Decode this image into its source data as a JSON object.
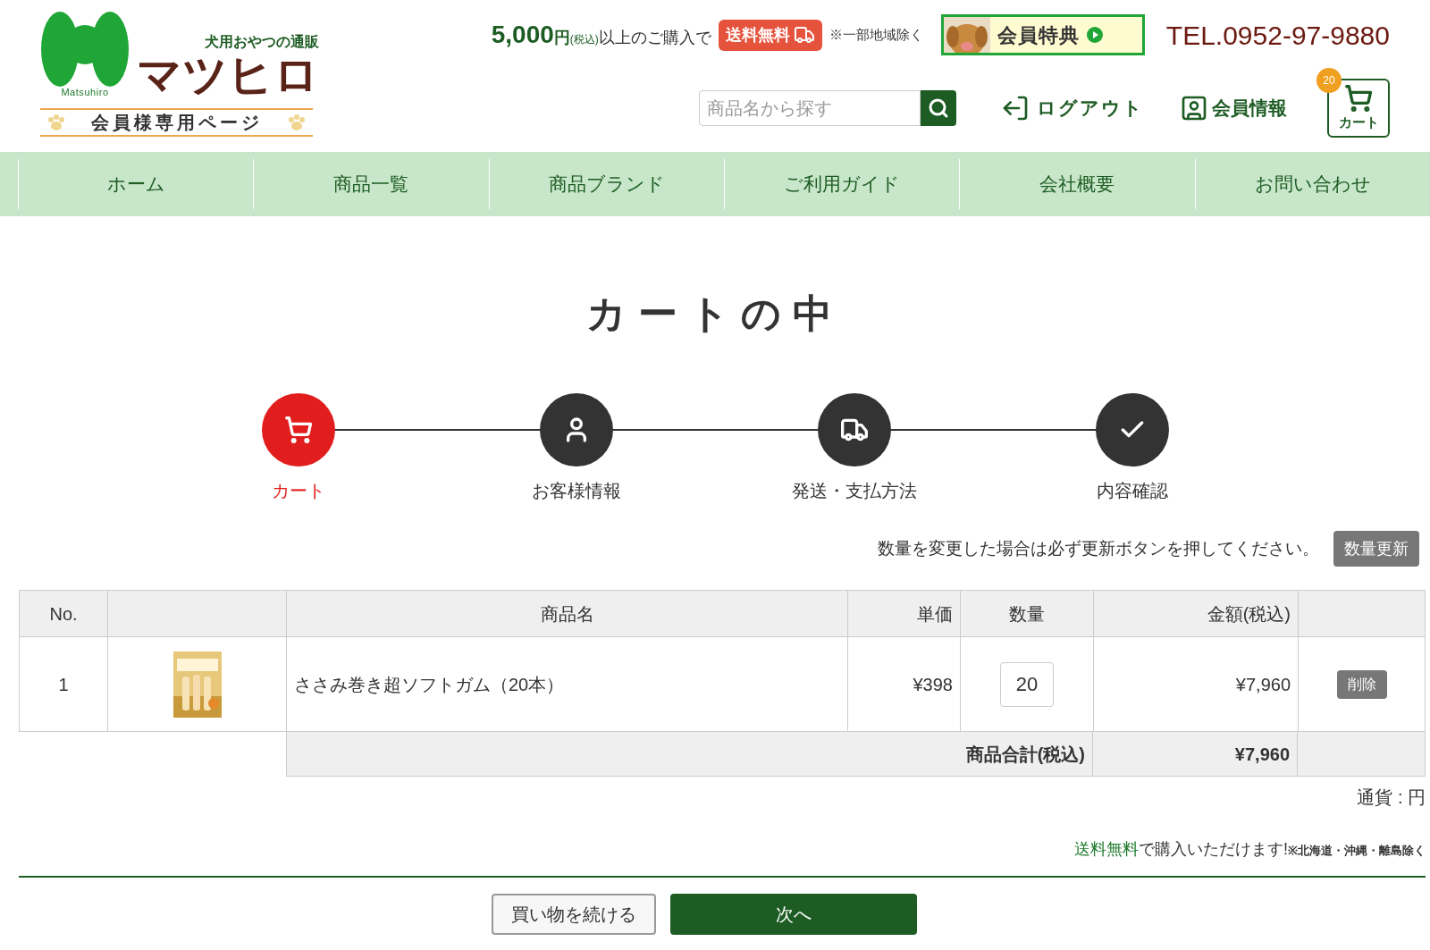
{
  "header": {
    "tagline": "犬用おやつの通販",
    "brand": "マツヒロ",
    "brand_roman": "Matsuhiro",
    "member_page": "会員様専用ページ",
    "shipping": {
      "amount": "5,000",
      "unit": "円",
      "tax": "(税込)",
      "text": "以上のご購入で",
      "badge": "送料無料",
      "note": "※一部地域除く"
    },
    "member_banner": "会員特典",
    "tel": "TEL.0952-97-9880",
    "search": {
      "placeholder": "商品名から探す"
    },
    "logout": "ログアウト",
    "member_info": "会員情報",
    "cart": {
      "label": "カート",
      "count": "20"
    }
  },
  "nav": [
    "ホーム",
    "商品一覧",
    "商品ブランド",
    "ご利用ガイド",
    "会社概要",
    "お問い合わせ"
  ],
  "title": "カートの中",
  "steps": [
    {
      "kind": "cart",
      "label": "カート",
      "selected": true
    },
    {
      "kind": "user",
      "label": "お客様情報",
      "selected": false
    },
    {
      "kind": "truck",
      "label": "発送・支払方法",
      "selected": false
    },
    {
      "kind": "check",
      "label": "内容確認",
      "selected": false
    }
  ],
  "notice": "数量を変更した場合は必ず更新ボタンを押してください。",
  "update_button": "数量更新",
  "table": {
    "columns": [
      "No.",
      "商品名",
      "単価",
      "数量",
      "金額(税込)"
    ],
    "rows": [
      {
        "no": "1",
        "name": "ささみ巻き超ソフトガム（20本）",
        "price": "¥398",
        "quantity": "20",
        "amount": "¥7,960",
        "delete": "削除"
      }
    ],
    "total_label": "商品合計(税込)",
    "total": "¥7,960"
  },
  "currency": "通貨 : 円",
  "free_note": {
    "highlight": "送料無料",
    "text": "で購入いただけます!",
    "small": "※北海道・沖縄・離島除く"
  },
  "buttons": {
    "continue": "買い物を続ける",
    "next": "次へ"
  }
}
